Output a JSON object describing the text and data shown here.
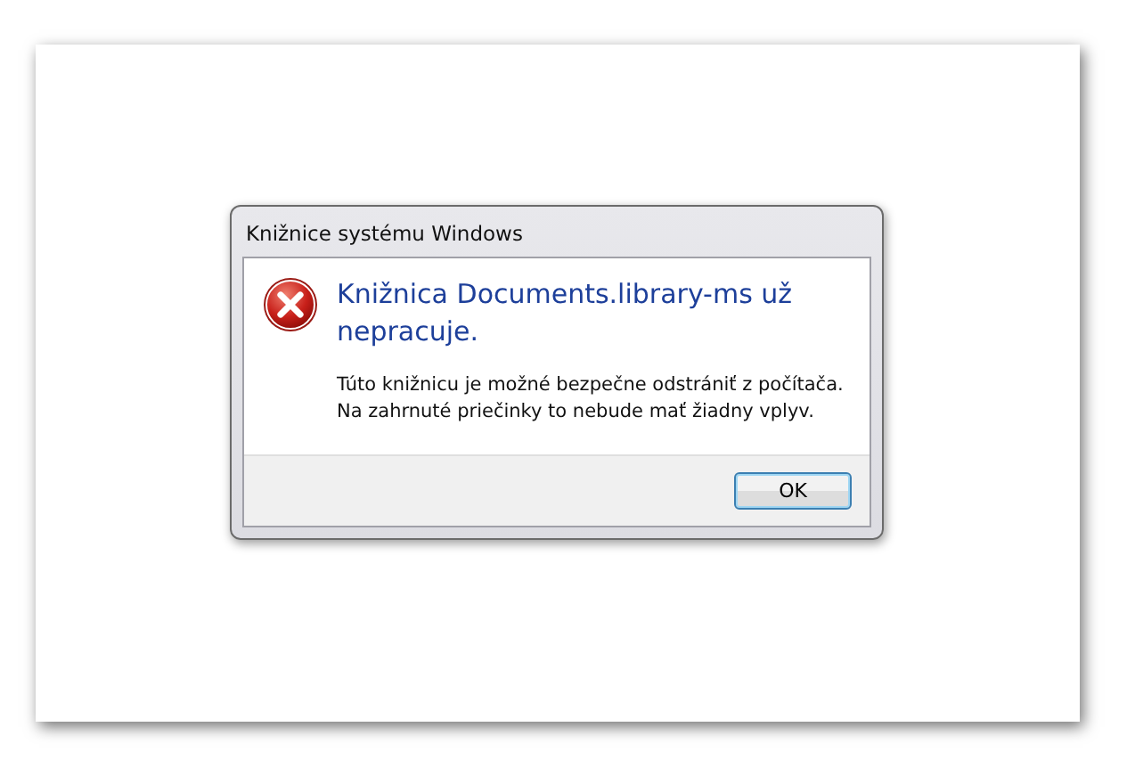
{
  "window": {
    "title": "Knižnice systému Windows"
  },
  "heading": "Knižnica Documents.library-ms už nepracuje.",
  "message": "Túto knižnicu je možné bezpečne odstrániť z počítača.\nNa zahrnuté priečinky to nebude mať žiadny vplyv.",
  "buttons": [
    {
      "label": "OK",
      "selected": true
    }
  ]
}
